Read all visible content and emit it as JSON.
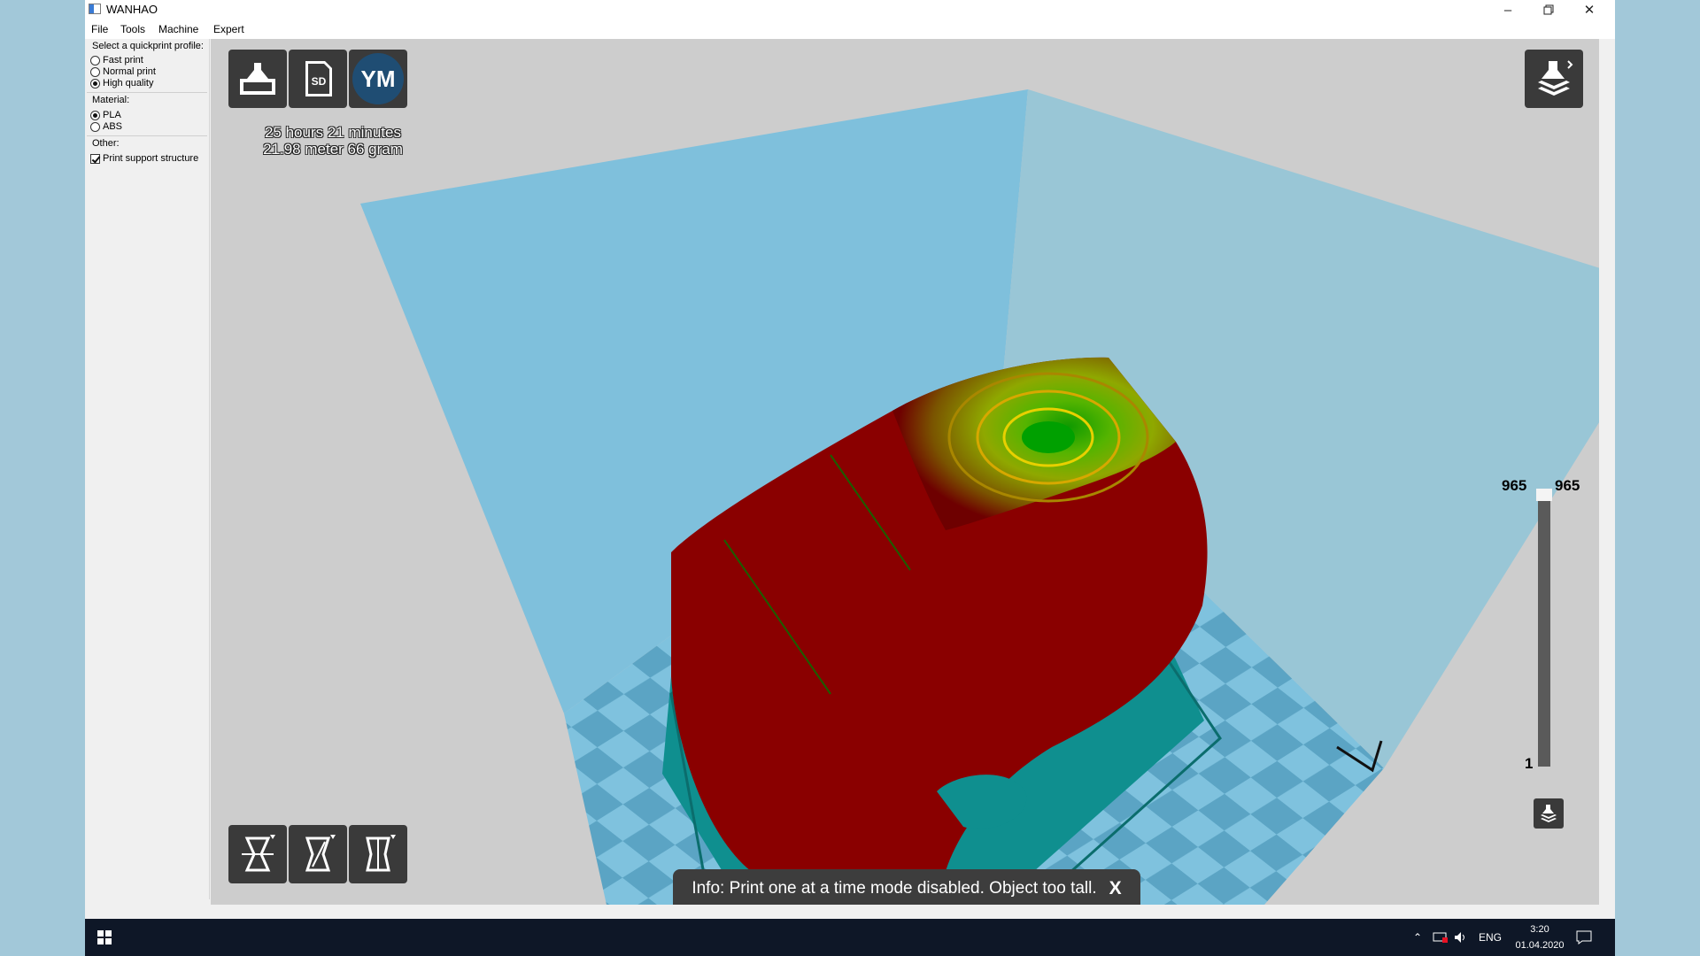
{
  "window": {
    "title": "WANHAO"
  },
  "menu": [
    "File",
    "Tools",
    "Machine",
    "Expert"
  ],
  "sidebar": {
    "profile_label": "Select a quickprint profile:",
    "profiles": [
      {
        "label": "Fast print",
        "selected": false
      },
      {
        "label": "Normal print",
        "selected": false
      },
      {
        "label": "High quality",
        "selected": true
      }
    ],
    "material_label": "Material:",
    "materials": [
      {
        "label": "PLA",
        "selected": true
      },
      {
        "label": "ABS",
        "selected": false
      }
    ],
    "other_label": "Other:",
    "support": {
      "label": "Print support structure",
      "checked": true
    }
  },
  "viewport": {
    "toolbar": {
      "buttons": [
        {
          "name": "load-model",
          "icon": "load-icon"
        },
        {
          "name": "save-sd",
          "icon": "sd-card-icon",
          "text": "SD"
        },
        {
          "name": "youmagine",
          "icon": "youmagine-icon",
          "text": "YM"
        }
      ]
    },
    "print_time": "25 hours 21 minutes",
    "print_material": "21.98 meter 66 gram",
    "layer_view": {
      "current_left": "965",
      "current_right": "965",
      "bottom": "1",
      "level_fraction": 1.0
    },
    "model_tools": [
      "rotate-icon",
      "scale-icon",
      "mirror-icon"
    ],
    "info_message": "Info: Print one at a time mode disabled. Object too tall.",
    "info_close": "X"
  },
  "taskbar": {
    "lang": "ENG",
    "time": "3:20",
    "date": "01.04.2020"
  },
  "colors": {
    "build_volume": "#7fc0dc",
    "model_outer": "#8a0000",
    "model_top": "#3aa10b",
    "support": "#0f8f8f",
    "viewport_bg": "#cdcdcd"
  }
}
